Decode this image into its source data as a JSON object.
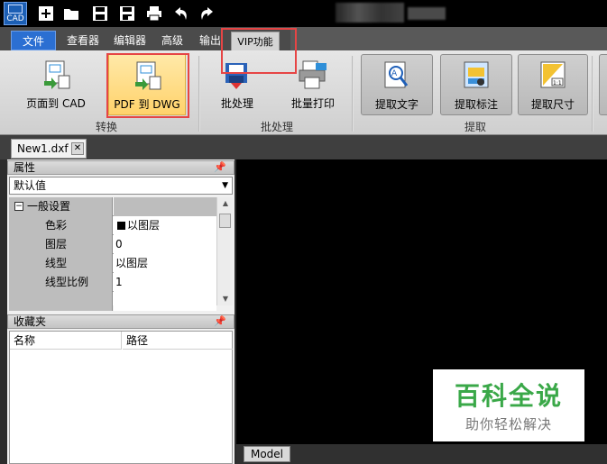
{
  "titlebar": {
    "app_logo": "CAD",
    "quick_access": [
      "new-icon",
      "open-folder-icon",
      "save-icon",
      "save-as-icon",
      "print-icon",
      "undo-icon",
      "redo-icon"
    ]
  },
  "menu_tabs": {
    "file": "文件",
    "viewer": "查看器",
    "editor": "编辑器",
    "advanced": "高级",
    "output": "输出",
    "vip": "VIP功能"
  },
  "ribbon": {
    "page_to_cad": "页面到 CAD",
    "pdf_to_dwg": "PDF 到 DWG",
    "batch_process": "批处理",
    "batch_print": "批量打印",
    "extract_text": "提取文字",
    "extract_annotation": "提取标注",
    "extract_dimension": "提取尺寸",
    "group_convert": "转换",
    "group_batch": "批处理",
    "group_extract": "提取"
  },
  "document_tab": {
    "name": "New1.dxf",
    "close": "✕"
  },
  "properties_panel": {
    "title": "属性",
    "pin": "ᵖ",
    "selected": "默认值",
    "category": "一般设置",
    "rows": [
      {
        "key": "色彩",
        "value": "以图层",
        "swatch": "#000000"
      },
      {
        "key": "图层",
        "value": "0"
      },
      {
        "key": "线型",
        "value": "以图层"
      },
      {
        "key": "线型比例",
        "value": "1"
      }
    ]
  },
  "favorites_panel": {
    "title": "收藏夹",
    "pin": "ᵖ",
    "col_name": "名称",
    "col_path": "路径"
  },
  "canvas": {
    "model_tab": "Model"
  },
  "watermark": {
    "main": "百科全说",
    "sub": "助你轻松解决"
  },
  "colors": {
    "file_tab": "#2b6fd2",
    "highlight": "#ffd26b",
    "red_box": "#e64545",
    "watermark_green": "#3aa848"
  }
}
